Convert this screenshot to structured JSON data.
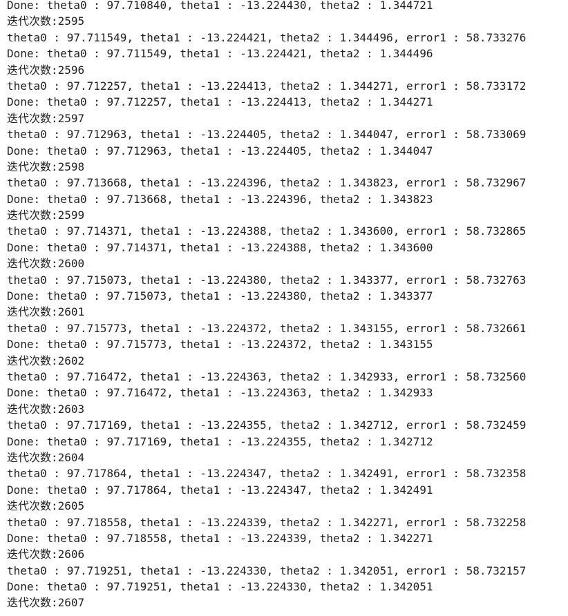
{
  "console": {
    "lines": [
      "Done: theta0 : 97.710840, theta1 : -13.224430, theta2 : 1.344721",
      "迭代次数:2595",
      "theta0 : 97.711549, theta1 : -13.224421, theta2 : 1.344496, error1 : 58.733276",
      "Done: theta0 : 97.711549, theta1 : -13.224421, theta2 : 1.344496",
      "迭代次数:2596",
      "theta0 : 97.712257, theta1 : -13.224413, theta2 : 1.344271, error1 : 58.733172",
      "Done: theta0 : 97.712257, theta1 : -13.224413, theta2 : 1.344271",
      "迭代次数:2597",
      "theta0 : 97.712963, theta1 : -13.224405, theta2 : 1.344047, error1 : 58.733069",
      "Done: theta0 : 97.712963, theta1 : -13.224405, theta2 : 1.344047",
      "迭代次数:2598",
      "theta0 : 97.713668, theta1 : -13.224396, theta2 : 1.343823, error1 : 58.732967",
      "Done: theta0 : 97.713668, theta1 : -13.224396, theta2 : 1.343823",
      "迭代次数:2599",
      "theta0 : 97.714371, theta1 : -13.224388, theta2 : 1.343600, error1 : 58.732865",
      "Done: theta0 : 97.714371, theta1 : -13.224388, theta2 : 1.343600",
      "迭代次数:2600",
      "theta0 : 97.715073, theta1 : -13.224380, theta2 : 1.343377, error1 : 58.732763",
      "Done: theta0 : 97.715073, theta1 : -13.224380, theta2 : 1.343377",
      "迭代次数:2601",
      "theta0 : 97.715773, theta1 : -13.224372, theta2 : 1.343155, error1 : 58.732661",
      "Done: theta0 : 97.715773, theta1 : -13.224372, theta2 : 1.343155",
      "迭代次数:2602",
      "theta0 : 97.716472, theta1 : -13.224363, theta2 : 1.342933, error1 : 58.732560",
      "Done: theta0 : 97.716472, theta1 : -13.224363, theta2 : 1.342933",
      "迭代次数:2603",
      "theta0 : 97.717169, theta1 : -13.224355, theta2 : 1.342712, error1 : 58.732459",
      "Done: theta0 : 97.717169, theta1 : -13.224355, theta2 : 1.342712",
      "迭代次数:2604",
      "theta0 : 97.717864, theta1 : -13.224347, theta2 : 1.342491, error1 : 58.732358",
      "Done: theta0 : 97.717864, theta1 : -13.224347, theta2 : 1.342491",
      "迭代次数:2605",
      "theta0 : 97.718558, theta1 : -13.224339, theta2 : 1.342271, error1 : 58.732258",
      "Done: theta0 : 97.718558, theta1 : -13.224339, theta2 : 1.342271",
      "迭代次数:2606",
      "theta0 : 97.719251, theta1 : -13.224330, theta2 : 1.342051, error1 : 58.732157",
      "Done: theta0 : 97.719251, theta1 : -13.224330, theta2 : 1.342051",
      "迭代次数:2607"
    ]
  }
}
